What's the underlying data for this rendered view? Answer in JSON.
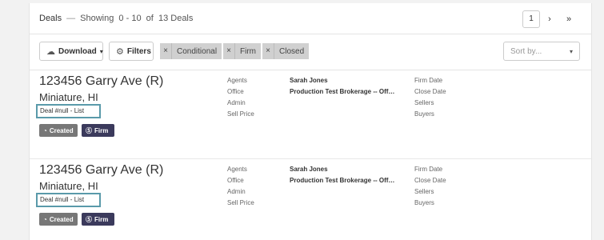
{
  "header": {
    "title": "Deals",
    "separator": "—",
    "showing": "Showing  0 - 10  of  13 Deals",
    "current_page": "1",
    "next_symbol": "›",
    "last_symbol": "»"
  },
  "toolbar": {
    "download_label": "Download",
    "filters_label": "Filters",
    "sort_placeholder": "Sort by...",
    "chips": [
      {
        "remove": "×",
        "label": "Conditional"
      },
      {
        "remove": "×",
        "label": "Firm"
      },
      {
        "remove": "×",
        "label": "Closed"
      }
    ]
  },
  "field_labels": {
    "agents": "Agents",
    "office": "Office",
    "admin": "Admin",
    "sell_price": "Sell Price",
    "firm_date": "Firm Date",
    "close_date": "Close Date",
    "sellers": "Sellers",
    "buyers": "Buyers"
  },
  "deals": [
    {
      "address": "123456 Garry Ave (R)",
      "city": "Miniature, HI",
      "deal_number": "Deal #null - List",
      "agent": "Sarah Jones",
      "office": "Production Test Brokerage -- Off…",
      "badges": {
        "created": "Created",
        "firm": "Firm"
      }
    },
    {
      "address": "123456 Garry Ave (R)",
      "city": "Miniature, HI",
      "deal_number": "Deal #null - List",
      "agent": "Sarah Jones",
      "office": "Production Test Brokerage -- Off…",
      "badges": {
        "created": "Created",
        "firm": "Firm"
      }
    }
  ],
  "colors": {
    "highlight_border": "#5a9aaa",
    "created_badge": "#777777",
    "firm_badge": "#3b3a5c"
  }
}
